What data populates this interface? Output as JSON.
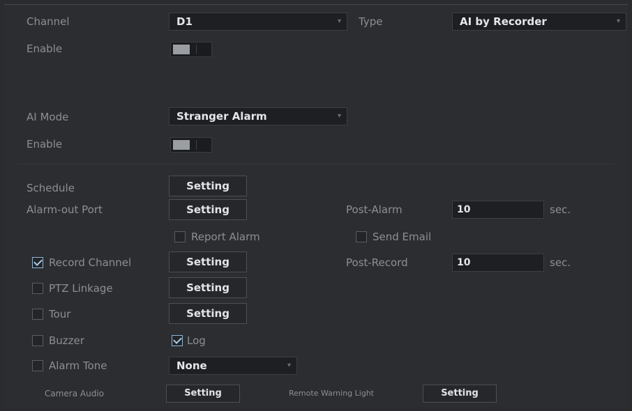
{
  "channel": {
    "label": "Channel",
    "value": "D1"
  },
  "type": {
    "label": "Type",
    "value": "AI by Recorder"
  },
  "enable_1": {
    "label": "Enable"
  },
  "ai_mode": {
    "label": "AI Mode",
    "value": "Stranger Alarm"
  },
  "enable_2": {
    "label": "Enable"
  },
  "schedule": {
    "label": "Schedule",
    "button": "Setting"
  },
  "alarm_out": {
    "label": "Alarm-out Port",
    "button": "Setting"
  },
  "post_alarm": {
    "label": "Post-Alarm",
    "value": "10",
    "unit": "sec."
  },
  "report_alarm": {
    "label": "Report Alarm",
    "checked": false
  },
  "send_email": {
    "label": "Send Email",
    "checked": false
  },
  "record_channel": {
    "label": "Record Channel",
    "checked": true,
    "button": "Setting"
  },
  "post_record": {
    "label": "Post-Record",
    "value": "10",
    "unit": "sec."
  },
  "ptz_linkage": {
    "label": "PTZ Linkage",
    "checked": false,
    "button": "Setting"
  },
  "tour": {
    "label": "Tour",
    "checked": false,
    "button": "Setting"
  },
  "buzzer": {
    "label": "Buzzer",
    "checked": false
  },
  "log": {
    "label": "Log",
    "checked": true
  },
  "alarm_tone": {
    "label": "Alarm Tone",
    "checked": false,
    "value": "None"
  },
  "camera_audio": {
    "label": "Camera Audio",
    "button": "Setting"
  },
  "remote_warning_light": {
    "label": "Remote Warning Light",
    "button": "Setting"
  },
  "icons": {
    "dropdown": "chevron-down-icon",
    "checkbox": "checkbox-icon"
  }
}
